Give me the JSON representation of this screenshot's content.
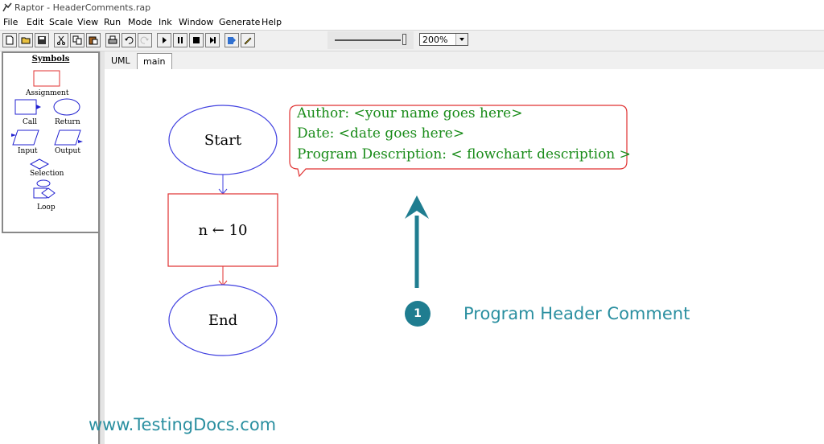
{
  "window": {
    "title": "Raptor - HeaderComments.rap"
  },
  "menu": [
    "File",
    "Edit",
    "Scale",
    "View",
    "Run",
    "Mode",
    "Ink",
    "Window",
    "Generate",
    "Help"
  ],
  "toolbar": {
    "buttons": [
      "new-file-icon",
      "open-folder-icon",
      "save-icon",
      "cut-icon",
      "copy-icon",
      "paste-icon",
      "print-icon",
      "undo-icon",
      "redo-icon",
      "play-icon",
      "pause-icon",
      "stop-icon",
      "step-icon",
      "test-server-icon",
      "pen-icon"
    ],
    "zoom": "200%"
  },
  "symbols": {
    "title": "Symbols",
    "items": [
      "Assignment",
      "Call",
      "Return",
      "Input",
      "Output",
      "Selection",
      "Loop"
    ]
  },
  "tabs": [
    "UML",
    "main"
  ],
  "flowchart": {
    "start": "Start",
    "assignment": "n ← 10",
    "end": "End",
    "comment": [
      "Author: <your name goes here>",
      "Date: <date goes here>",
      "Program Description: < flowchart description >"
    ]
  },
  "annotation": {
    "step": "1",
    "label": "Program Header Comment"
  },
  "watermark": "www.TestingDocs.com",
  "colors": {
    "accent": "#1f7d90",
    "comment_text": "#1a8c1a",
    "comment_border": "#e03030",
    "shape_blue": "#4040e0",
    "shape_red": "#e03030"
  }
}
